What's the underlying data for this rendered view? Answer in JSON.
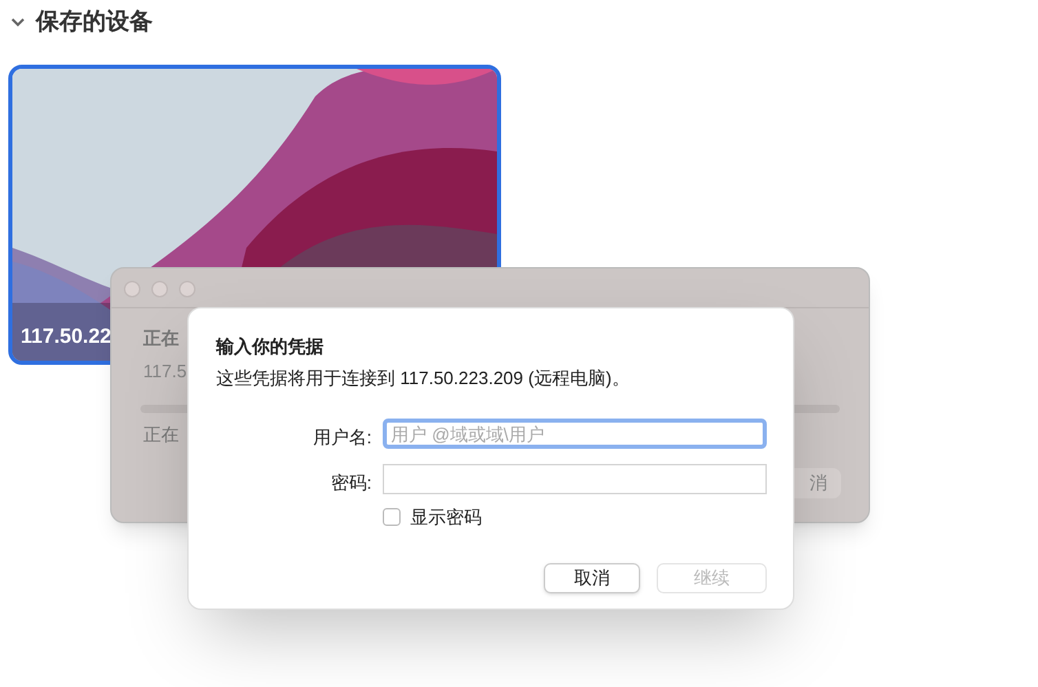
{
  "section": {
    "title": "保存的设备",
    "expanded": true
  },
  "devices": [
    {
      "label": "117.50.22",
      "selected": true
    }
  ],
  "background_window": {
    "status": "正在",
    "address": "117.5",
    "step": "正在",
    "button": "消"
  },
  "dialog": {
    "title": "输入你的凭据",
    "message": "这些凭据将用于连接到 117.50.223.209 (远程电脑)。",
    "fields": [
      {
        "label": "用户名:",
        "placeholder": "用户 @域或域\\用户",
        "focused": true
      },
      {
        "label": "密码:",
        "focused": false
      }
    ],
    "show_password": {
      "label": "显示密码",
      "checked": false
    },
    "buttons": [
      {
        "label": "取消",
        "disabled": false
      },
      {
        "label": "继续",
        "disabled": true
      }
    ]
  }
}
